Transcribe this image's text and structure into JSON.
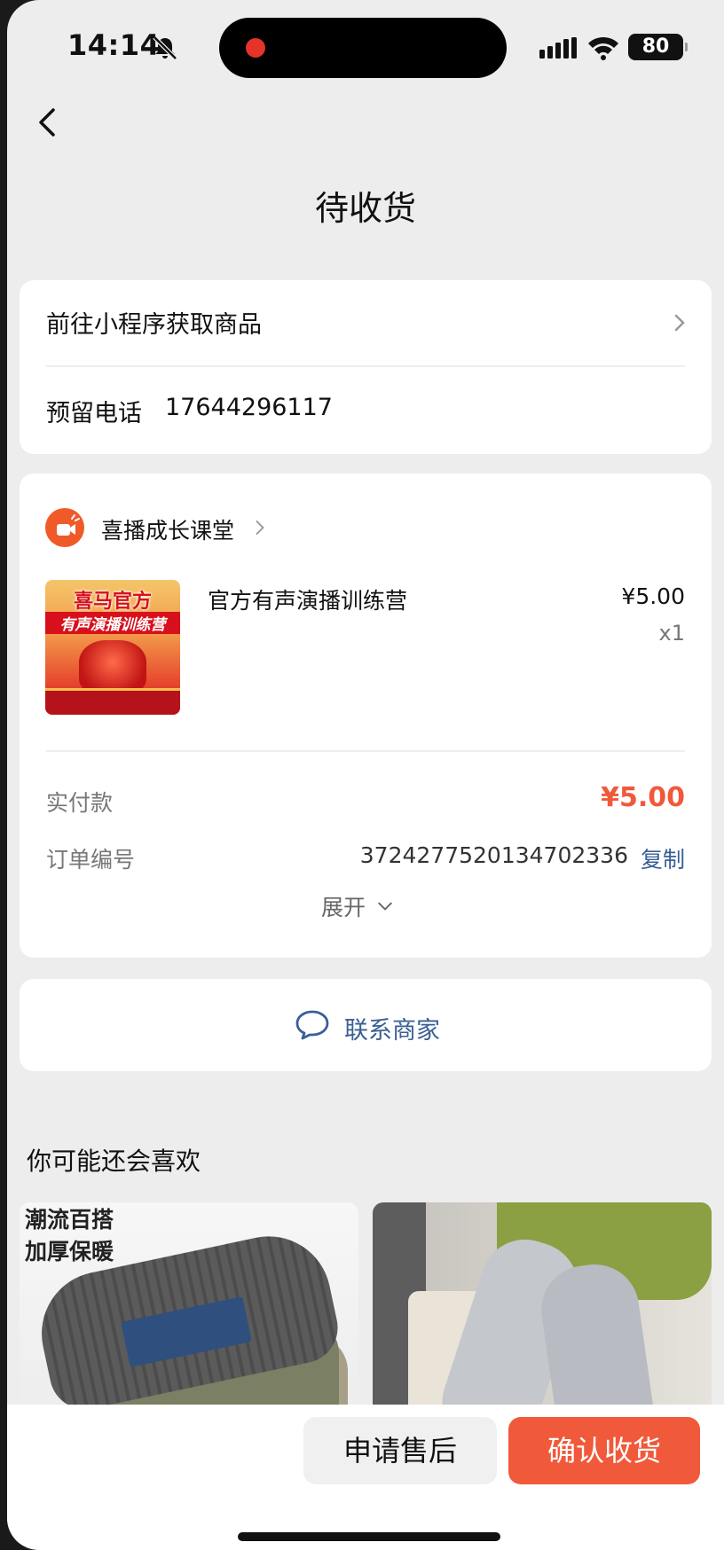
{
  "status_bar": {
    "time": "14:14",
    "battery": "80"
  },
  "page": {
    "title": "待收货"
  },
  "pickup_card": {
    "title": "前往小程序获取商品",
    "phone_label": "预留电话",
    "phone_value": "17644296117"
  },
  "order_card": {
    "shop_name": "喜播成长课堂",
    "product": {
      "image_line1": "喜马官方",
      "image_line2": "有声演播训练营",
      "name": "官方有声演播训练营",
      "price": "¥5.00",
      "quantity": "x1"
    },
    "paid_label": "实付款",
    "paid_value": "¥5.00",
    "order_no_label": "订单编号",
    "order_no_value": "3724277520134702336",
    "copy_label": "复制",
    "expand_label": "展开"
  },
  "contact": {
    "label": "联系商家"
  },
  "recommend": {
    "title": "你可能还会喜欢",
    "item1_caption_line1": "潮流百搭",
    "item1_caption_line2": "加厚保暖"
  },
  "bottom_bar": {
    "after_sale_label": "申请售后",
    "confirm_label": "确认收货"
  },
  "colors": {
    "accent": "#f0593a",
    "link": "#3a5f95",
    "shop_icon": "#f05a28",
    "page_bg": "#ededed"
  },
  "icons": [
    "bell-off-icon",
    "signal-icon",
    "wifi-icon",
    "battery-icon",
    "back-arrow-icon",
    "chevron-right-icon",
    "shop-logo-icon",
    "chevron-down-icon",
    "chat-bubble-icon"
  ]
}
